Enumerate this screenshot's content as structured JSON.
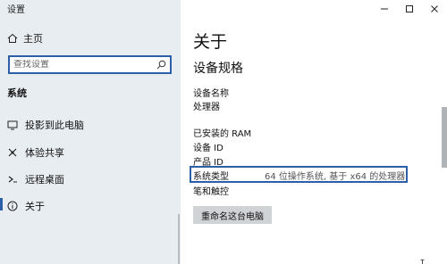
{
  "window": {
    "title": "设置"
  },
  "sidebar": {
    "home_label": "主页",
    "search": {
      "placeholder": "查找设置",
      "value": ""
    },
    "section_label": "系统",
    "items": [
      {
        "label": "投影到此电脑",
        "icon": "projector-icon"
      },
      {
        "label": "体验共享",
        "icon": "share-icon"
      },
      {
        "label": "远程桌面",
        "icon": "remote-desktop-icon"
      },
      {
        "label": "关于",
        "icon": "info-icon",
        "selected": true
      }
    ]
  },
  "main": {
    "title": "关于",
    "section_heading": "设备规格",
    "specs": [
      {
        "label": "设备名称",
        "value": ""
      },
      {
        "label": "处理器",
        "value": ""
      },
      {
        "label": "已安装的 RAM",
        "value": ""
      },
      {
        "label": "设备 ID",
        "value": ""
      },
      {
        "label": "产品 ID",
        "value": ""
      },
      {
        "label": "系统类型",
        "value": "64 位操作系统, 基于 x64 的处理器",
        "highlighted": true
      },
      {
        "label": "笔和触控",
        "value": ""
      }
    ],
    "rename_button": "重命名这台电脑"
  },
  "colors": {
    "accent": "#2b5fa8",
    "sidebar_bg": "#e8edf2",
    "button_bg": "#d0d3d6"
  }
}
